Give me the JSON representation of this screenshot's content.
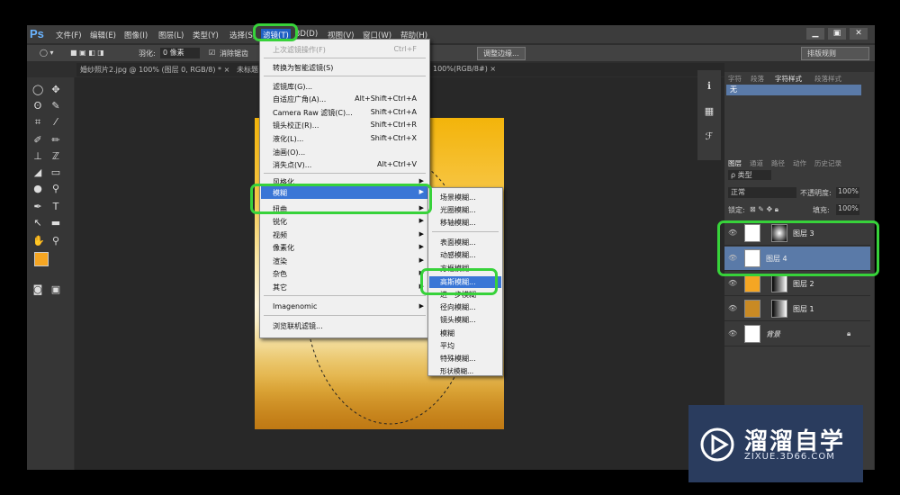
{
  "app": {
    "logo": "Ps"
  },
  "menubar": {
    "items": [
      "文件(F)",
      "编辑(E)",
      "图像(I)",
      "图层(L)",
      "类型(Y)",
      "选择(S)",
      "滤镜(T)",
      "3D(D)",
      "视图(V)",
      "窗口(W)",
      "帮助(H)"
    ],
    "win_min": "▁",
    "win_restore": "▣",
    "win_close": "✕"
  },
  "options": {
    "feather_label": "羽化:",
    "feather_value": "0 像素",
    "antialias_label": "消除锯齿",
    "adjust_edge": "调整边缘...",
    "workspace": "排版规则"
  },
  "tabs": {
    "doc1": "婚纱照片2.jpg @ 100% (图层 0, RGB/8) * ×",
    "doc2": "未标题",
    "doc3": "100%(RGB/8#) ×"
  },
  "filter_menu": {
    "last_filter": "上次滤镜操作(F)",
    "last_filter_sc": "Ctrl+F",
    "convert_smart": "转换为智能滤镜(S)",
    "items": [
      {
        "label": "滤镜库(G)...",
        "sc": ""
      },
      {
        "label": "自适应广角(A)...",
        "sc": "Alt+Shift+Ctrl+A"
      },
      {
        "label": "Camera Raw 滤镜(C)...",
        "sc": "Shift+Ctrl+A"
      },
      {
        "label": "镜头校正(R)...",
        "sc": "Shift+Ctrl+R"
      },
      {
        "label": "液化(L)...",
        "sc": "Shift+Ctrl+X"
      },
      {
        "label": "油画(O)...",
        "sc": ""
      },
      {
        "label": "消失点(V)...",
        "sc": "Alt+Ctrl+V"
      }
    ],
    "groups": [
      "风格化",
      "模糊",
      "扭曲",
      "锐化",
      "视频",
      "像素化",
      "渲染",
      "杂色",
      "其它"
    ],
    "imagenomic": "Imagenomic",
    "browse": "浏览联机滤镜..."
  },
  "blur_submenu": [
    "场景模糊...",
    "光圈模糊...",
    "移轴模糊...",
    "表面模糊...",
    "动感模糊...",
    "方框模糊...",
    "高斯模糊...",
    "进一步模糊",
    "径向模糊...",
    "镜头模糊...",
    "模糊",
    "平均",
    "特殊模糊...",
    "形状模糊..."
  ],
  "char_panel": {
    "tabs": [
      "字符",
      "段落",
      "字符样式",
      "段落样式"
    ],
    "style": "无"
  },
  "layers_panel": {
    "tabs": [
      "图层",
      "通道",
      "路径",
      "动作",
      "历史记录"
    ],
    "filter_kind": "ρ 类型",
    "blend_mode": "正常",
    "opacity_label": "不透明度:",
    "opacity_value": "100%",
    "lock_label": "锁定:",
    "fill_label": "填充:",
    "fill_value": "100%",
    "layers": [
      "图层 3",
      "图层 4",
      "图层 2",
      "图层 1",
      "背景"
    ]
  },
  "watermark": {
    "title": "溜溜自学",
    "url": "ZIXUE.3D66.COM"
  },
  "colors": {
    "highlight": "#37d23a",
    "selection": "#3a76d6",
    "fg_swatch": "#f5a623"
  }
}
